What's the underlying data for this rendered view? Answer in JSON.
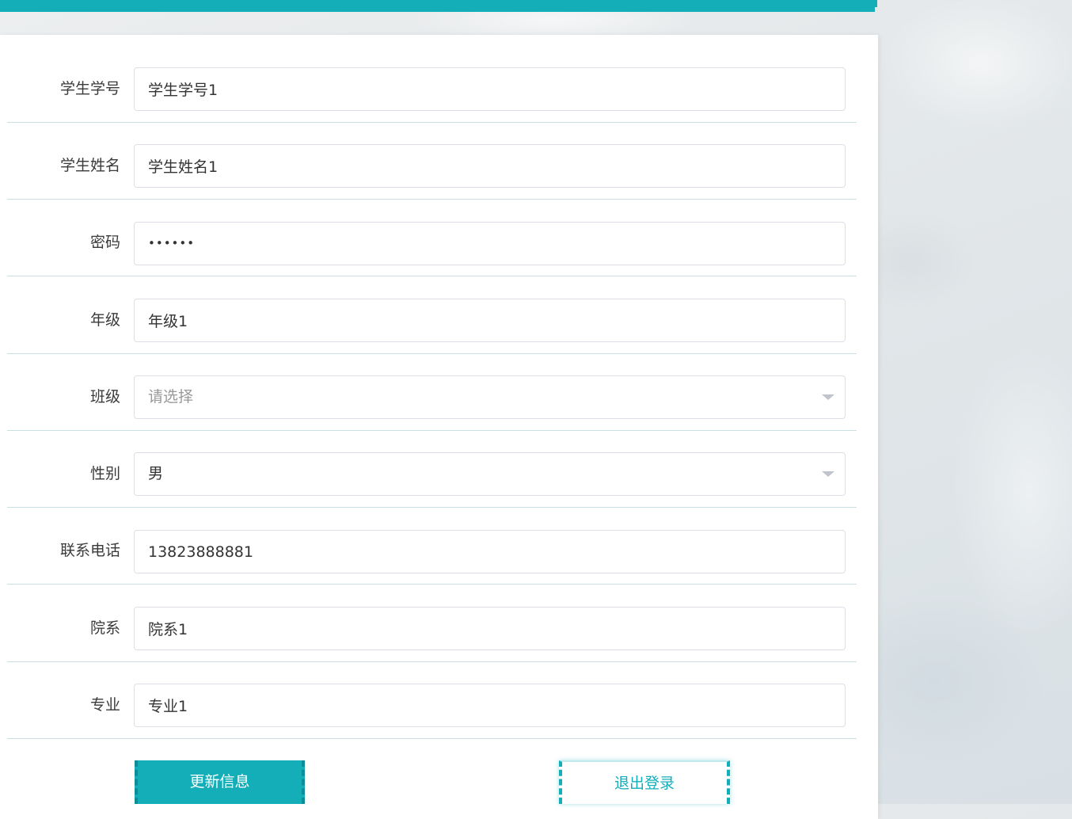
{
  "form": {
    "fields": [
      {
        "label": "学生学号",
        "value": "学生学号1",
        "type": "text"
      },
      {
        "label": "学生姓名",
        "value": "学生姓名1",
        "type": "text"
      },
      {
        "label": "密码",
        "value": "••••••",
        "type": "password"
      },
      {
        "label": "年级",
        "value": "年级1",
        "type": "text"
      },
      {
        "label": "班级",
        "placeholder": "请选择",
        "type": "select"
      },
      {
        "label": "性别",
        "value": "男",
        "type": "select"
      },
      {
        "label": "联系电话",
        "value": "13823888881",
        "type": "text"
      },
      {
        "label": "院系",
        "value": "院系1",
        "type": "text"
      },
      {
        "label": "专业",
        "value": "专业1",
        "type": "text"
      }
    ]
  },
  "actions": {
    "update_label": "更新信息",
    "logout_label": "退出登录"
  },
  "colors": {
    "accent": "#14aeb8",
    "border": "#dcdfe6",
    "divider": "#c9dfe2",
    "placeholder": "#999999"
  },
  "icons": {
    "select_caret": "chevron-down-icon"
  }
}
